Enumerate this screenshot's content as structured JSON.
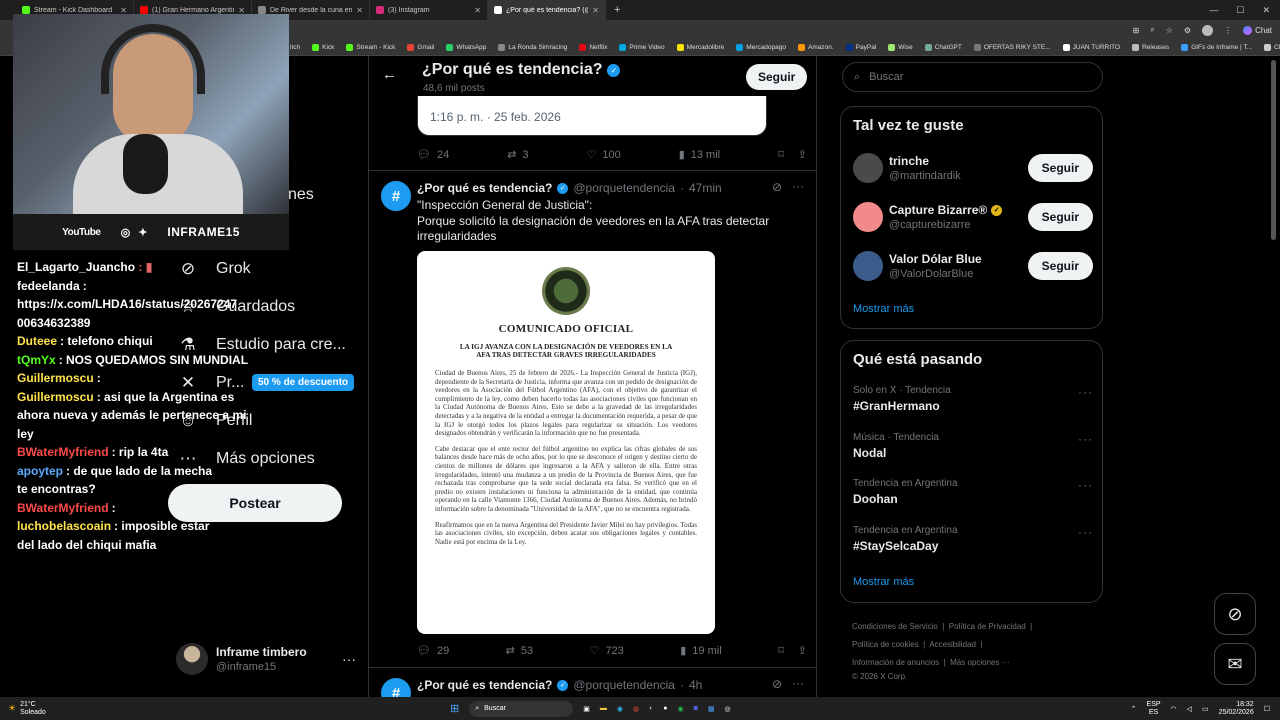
{
  "browser": {
    "tabs": [
      {
        "label": "Stream - Kick Dashboard",
        "color": "#53fc18"
      },
      {
        "label": "(1) Gran Hermano Argentina - Yo...",
        "color": "#ff0000"
      },
      {
        "label": "De River desde la cuna en X: \"",
        "color": "#888888"
      },
      {
        "label": "(3) Instagram",
        "color": "#d62976"
      },
      {
        "label": "¿Por qué es tendencia? (@porque...",
        "color": "#ffffff",
        "active": true
      }
    ],
    "bookmarks": [
      "Kick",
      "Stream - Kick",
      "Gmail",
      "WhatsApp",
      "La Ronda Simracing",
      "Netflix",
      "Prime Video",
      "Mercadolibre",
      "Mercadopago",
      "Amazon.",
      "PayPal",
      "Wise",
      "ChatGPT",
      "OFERTAS RIKY STE...",
      "JUAN TURRITO",
      "Releases",
      "GIFs de Inframe | T...",
      "CRIPTO"
    ],
    "bookmark_partial": "itch",
    "chat_label": "Chat"
  },
  "webcam": {
    "youtube": "YouTube",
    "handle": "INFRAME15"
  },
  "chat": [
    {
      "user": "El_Lagarto_Juancho",
      "color": "#ffffff",
      "msg": "",
      "badge": "flag"
    },
    {
      "user": "fedeelanda",
      "color": "#ffffff",
      "msg": ":"
    },
    {
      "user": "",
      "color": "#ffffff",
      "msg": "https://x.com/LHDA16/status/20267247"
    },
    {
      "user": "",
      "color": "#ffffff",
      "msg": "00634632389"
    },
    {
      "user": "Duteee",
      "color": "#ffe34a",
      "msg": ": telefono chiqui"
    },
    {
      "user": "tQmYx",
      "color": "#53fc18",
      "msg": ": NOS QUEDAMOS SIN MUNDIAL"
    },
    {
      "user": "Guillermoscu",
      "color": "#ffe34a",
      "msg": ":"
    },
    {
      "user": "Guillermoscu",
      "color": "#ffe34a",
      "msg": ": asi que la Argentina es"
    },
    {
      "user": "",
      "color": "#ffffff",
      "msg": "ahora nueva y además le pertenece a mi"
    },
    {
      "user": "",
      "color": "#ffffff",
      "msg": "ley"
    },
    {
      "user": "BWaterMyfriend",
      "color": "#ff4a4a",
      "msg": ": rip la 4ta"
    },
    {
      "user": "apoytep",
      "color": "#5aa9ff",
      "msg": ": de que lado de la mecha"
    },
    {
      "user": "",
      "color": "#ffffff",
      "msg": "te encontras?"
    },
    {
      "user": "BWaterMyfriend",
      "color": "#ff4a4a",
      "msg": ":"
    },
    {
      "user": "luchobelascoain",
      "color": "#ffe34a",
      "msg": ": imposible estar"
    },
    {
      "user": "",
      "color": "#ffffff",
      "msg": "del lado del chiqui mafia"
    }
  ],
  "leftnav": {
    "partial_top": "nes",
    "items": [
      {
        "label": "Grok",
        "icon": "grok-icon",
        "glyph": "⊘"
      },
      {
        "label": "Guardados",
        "icon": "bookmark-icon",
        "glyph": "☆"
      },
      {
        "label": "Estudio para cre...",
        "icon": "lightning-icon",
        "glyph": "⚗"
      },
      {
        "label": "Pr...",
        "icon": "x-logo-icon",
        "glyph": "✕"
      },
      {
        "label": "Perfil",
        "icon": "profile-icon",
        "glyph": "☺"
      },
      {
        "label": "Más opciones",
        "icon": "more-circle-icon",
        "glyph": "⋯"
      }
    ],
    "premium_badge": "50 % de descuento",
    "post_button": "Postear",
    "account_name": "Inframe timbero",
    "account_handle": "@inframe15"
  },
  "header": {
    "title": "¿Por qué es tendencia?",
    "subtitle": "48,6 mil posts",
    "follow": "Seguir"
  },
  "tweet_prev": {
    "timestamp": "1:16 p. m. · 25 feb. 2026",
    "replies": "24",
    "reposts": "3",
    "likes": "100",
    "views": "13 mil"
  },
  "tweet": {
    "name": "¿Por qué es tendencia?",
    "handle": "@porquetendencia",
    "time": "47min",
    "line1": "\"Inspección General de Justicia\":",
    "line2": "Porque solicitó la designación de veedores en la AFA tras detectar",
    "line3": "irregularidades",
    "replies": "29",
    "reposts": "53",
    "likes": "723",
    "views": "19 mil"
  },
  "document": {
    "title": "COMUNICADO OFICIAL",
    "headline1": "LA IGJ AVANZA CON LA DESIGNACIÓN DE VEEDORES EN LA",
    "headline2": "AFA TRAS DETECTAR GRAVES IRREGULARIDADES",
    "p1": "Ciudad de Buenos Aires, 25 de febrero de 2026.- La Inspección General de Justicia (IGJ), dependiente de la Secretaría de Justicia, informa que avanza con un pedido de designación de veedores en la Asociación del Fútbol Argentino (AFA), con el objetivo de garantizar el cumplimiento de la ley, como deben hacerlo todas las asociaciones civiles que funcionan en la Ciudad Autónoma de Buenos Aires. Esto se debe a la gravedad de las irregularidades detectadas y a la negativa de la entidad a entregar la documentación requerida, a pesar de que la IGJ le otorgó todos los plazos legales para regularizar su situación. Los veedores designados obtendrán y verificarán la información que no fue presentada.",
    "p2": "Cabe destacar que el ente rector del fútbol argentino no explica las cifras globales de sus balances desde hace más de ocho años, por lo que se desconoce el origen y destino cierto de cientos de millones de dólares que ingresaron a la AFA y salieron de ella. Entre otras irregularidades, intentó una mudanza a un predio de la Provincia de Buenos Aires, que fue rechazada tras comprobarse que la sede social declarada era falsa. Se verificó que en el predio no existen instalaciones ni funciona la administración de la entidad, que continúa operando en la calle Viamonte 1366, Ciudad Autónoma de Buenos Aires. Además, no brindó información sobre la denominada \"Universidad de la AFA\", que no se encuentra registrada.",
    "p3": "Reafirmamos que en la nueva Argentina del Presidente Javier Milei no hay privilegios. Todas las asociaciones civiles, sin excepción, deben acatar sus obligaciones legales y contables. Nadie está por encima de la Ley."
  },
  "tweet_next": {
    "name": "¿Por qué es tendencia?",
    "handle": "@porquetendencia",
    "time": "4h"
  },
  "sidebar": {
    "search_placeholder": "Buscar",
    "wtf_title": "Tal vez te guste",
    "suggestions": [
      {
        "name": "trinche",
        "handle": "@martindardik",
        "verified": false,
        "avatar_color": "#4a4a4a"
      },
      {
        "name": "Capture Bizarre®",
        "handle": "@capturebizarre",
        "verified": true,
        "avatar_color": "#f28a8a"
      },
      {
        "name": "Valor Dólar Blue",
        "handle": "@ValorDolarBlue",
        "verified": false,
        "avatar_color": "#3b5c8a"
      }
    ],
    "follow_label": "Seguir",
    "show_more": "Mostrar más",
    "trends_title": "Qué está pasando",
    "trends": [
      {
        "meta": "Solo en X · Tendencia",
        "name": "#GranHermano"
      },
      {
        "meta": "Música · Tendencia",
        "name": "Nodal"
      },
      {
        "meta": "Tendencia en Argentina",
        "name": "Doohan"
      },
      {
        "meta": "Tendencia en Argentina",
        "name": "#StaySelcaDay"
      }
    ],
    "footer": [
      "Condiciones de Servicio",
      "Política de Privacidad",
      "Política de cookies",
      "Accesibilidad",
      "Información de anuncios",
      "Más opciones ···",
      "© 2026 X Corp."
    ]
  },
  "taskbar": {
    "weather_temp": "21°C",
    "weather_desc": "Soleado",
    "search": "Buscar",
    "lang1": "ESP",
    "lang2": "ES",
    "time": "18:32",
    "date": "25/02/2026"
  },
  "colors": {
    "accent": "#1d9bf0",
    "border": "#2f3336",
    "muted": "#71767b"
  }
}
